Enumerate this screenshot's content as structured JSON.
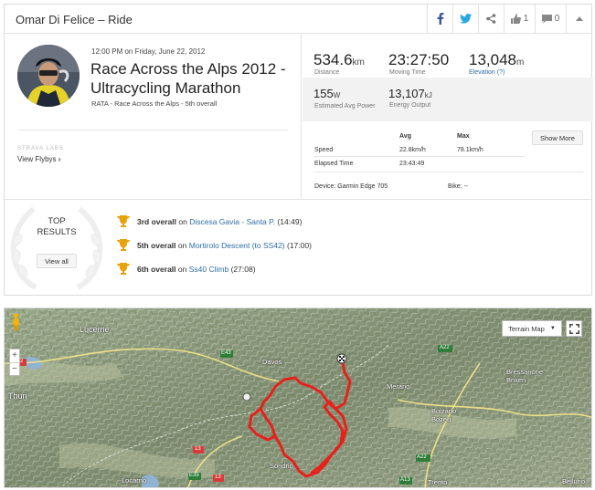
{
  "header": {
    "title": "Omar Di Felice – Ride",
    "kudos_count": "1",
    "comments_count": "0"
  },
  "athlete": {
    "datetime": "12:00 PM on Friday, June 22, 2012",
    "activity_title": "Race Across the Alps 2012 - Ultracycling Marathon",
    "subtitle": "RATA - Race Across the Alps - 5th overall"
  },
  "labs": {
    "label": "STRAVA LABS",
    "flyby_link": "View Flybys"
  },
  "stats": {
    "distance": {
      "value": "534.6",
      "unit": "km",
      "label": "Distance"
    },
    "moving_time": {
      "value": "23:27:50",
      "label": "Moving Time"
    },
    "elevation": {
      "value": "13,048",
      "unit": "m",
      "label": "Elevation (?)"
    },
    "power": {
      "value": "155",
      "unit": "W",
      "label": "Estimated Avg Power"
    },
    "energy": {
      "value": "13,107",
      "unit": "kJ",
      "label": "Energy Output"
    },
    "show_more": "Show More",
    "table": {
      "col_avg": "Avg",
      "col_max": "Max",
      "speed_label": "Speed",
      "speed_avg": "22.8km/h",
      "speed_max": "78.1km/h",
      "elapsed_label": "Elapsed Time",
      "elapsed_value": "23:43:49"
    },
    "device": "Device: Garmin Edge 705",
    "bike": "Bike: --"
  },
  "top_results": {
    "title_line1": "TOP",
    "title_line2": "RESULTS",
    "view_all": "View all",
    "items": [
      {
        "rank": "3rd overall",
        "on": "on",
        "segment": "Discesa Gavia - Santa P.",
        "time": "(14:49)"
      },
      {
        "rank": "5th overall",
        "on": "on",
        "segment": "Mortirolo Descent (to SS42)",
        "time": "(17:00)"
      },
      {
        "rank": "6th overall",
        "on": "on",
        "segment": "Ss40 Climb",
        "time": "(27:08)"
      }
    ],
    "trophy_color": "#e8a30c"
  },
  "map": {
    "type_selector": "Terrain Map",
    "zoom_in": "+",
    "zoom_out": "−",
    "route_color": "#e8201c",
    "labels": {
      "lucerne": "Lucerne",
      "thun": "Thun",
      "davos": "Davos",
      "merano": "Merano",
      "bolzano": "Bolzano\nBozen",
      "bressanone": "Bressanone\nBrixen",
      "sondrio": "Sondrio",
      "locarno": "Locarno",
      "trento": "Trento",
      "belluno": "Belluno",
      "r1": "A2",
      "r2": "13",
      "r3": "E35",
      "r4": "E43",
      "r5": "A22",
      "r6": "13",
      "r7": "A22",
      "r8": "A13"
    }
  },
  "colors": {
    "link": "#2e6da4",
    "facebook": "#3b5998",
    "twitter": "#2aa9e0"
  }
}
